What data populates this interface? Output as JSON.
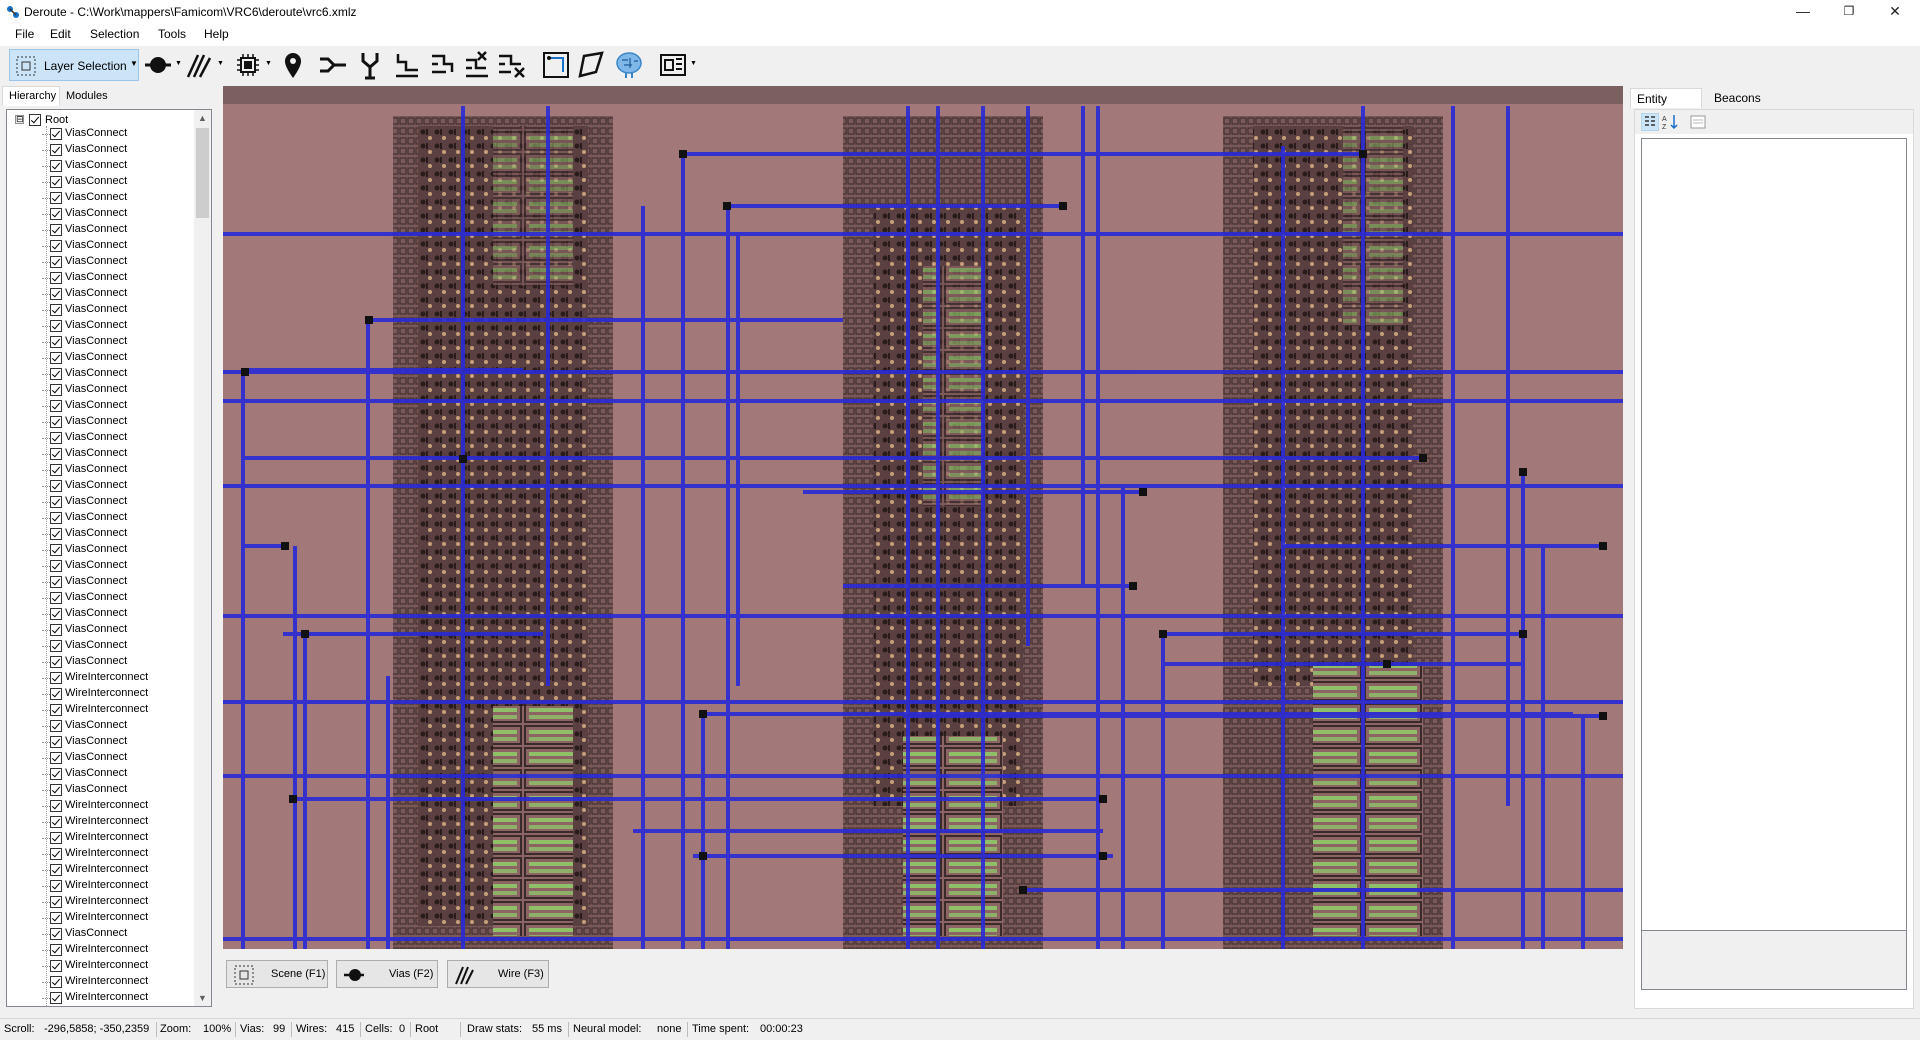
{
  "window": {
    "title": "Deroute - C:\\Work\\mappers\\Famicom\\VRC6\\deroute\\vrc6.xmlz",
    "minimize": "—",
    "restore": "❐",
    "close": "✕"
  },
  "menu": [
    "File",
    "Edit",
    "Selection",
    "Tools",
    "Help"
  ],
  "toolbar": {
    "layer_selection_label": "Layer Selection",
    "tools": [
      "vias-tool-icon",
      "wire-tool-icon",
      "cell-tool-icon",
      "beacon-tool-icon",
      "connect-tool-icon",
      "split-tool-icon",
      "stairs-tool-icon",
      "stairs-reverse-tool-icon",
      "stairs-x-tool-icon",
      "stairs-remove-tool-icon",
      "fit-icon",
      "shape-icon",
      "neural-icon",
      "module-icon"
    ]
  },
  "left_panel": {
    "tabs": [
      "Hierarchy",
      "Modules"
    ],
    "root_label": "Root",
    "expander": "⊟",
    "items": [
      "ViasConnect",
      "ViasConnect",
      "ViasConnect",
      "ViasConnect",
      "ViasConnect",
      "ViasConnect",
      "ViasConnect",
      "ViasConnect",
      "ViasConnect",
      "ViasConnect",
      "ViasConnect",
      "ViasConnect",
      "ViasConnect",
      "ViasConnect",
      "ViasConnect",
      "ViasConnect",
      "ViasConnect",
      "ViasConnect",
      "ViasConnect",
      "ViasConnect",
      "ViasConnect",
      "ViasConnect",
      "ViasConnect",
      "ViasConnect",
      "ViasConnect",
      "ViasConnect",
      "ViasConnect",
      "ViasConnect",
      "ViasConnect",
      "ViasConnect",
      "ViasConnect",
      "ViasConnect",
      "ViasConnect",
      "ViasConnect",
      "WireInterconnect",
      "WireInterconnect",
      "WireInterconnect",
      "ViasConnect",
      "ViasConnect",
      "ViasConnect",
      "ViasConnect",
      "ViasConnect",
      "WireInterconnect",
      "WireInterconnect",
      "WireInterconnect",
      "WireInterconnect",
      "WireInterconnect",
      "WireInterconnect",
      "WireInterconnect",
      "WireInterconnect",
      "ViasConnect",
      "WireInterconnect",
      "WireInterconnect",
      "WireInterconnect",
      "WireInterconnect"
    ]
  },
  "bottom_tools": [
    {
      "label": "Scene (F1)"
    },
    {
      "label": "Vias (F2)"
    },
    {
      "label": "Wire (F3)"
    }
  ],
  "right_panel": {
    "tabs": [
      "Entity Props",
      "Beacons"
    ]
  },
  "status": {
    "scroll_label": "Scroll:",
    "scroll_value": "-296,5858; -350,2359",
    "zoom_label": "Zoom:",
    "zoom_value": "100%",
    "vias_label": "Vias:",
    "vias_value": "99",
    "wires_label": "Wires:",
    "wires_value": "415",
    "cells_label": "Cells:",
    "cells_value": "0",
    "root": "Root",
    "draw_label": "Draw stats:",
    "draw_value": "55 ms",
    "neural_label": "Neural model:",
    "neural_value": "none",
    "time_label": "Time spent:",
    "time_value": "00:00:23"
  },
  "colors": {
    "die_background": "#a27878",
    "wire": "#2a2ad6",
    "diffusion": "#8fd06a",
    "cell_dark": "#3a2a2a",
    "selection_blue": "#cce4f7"
  }
}
